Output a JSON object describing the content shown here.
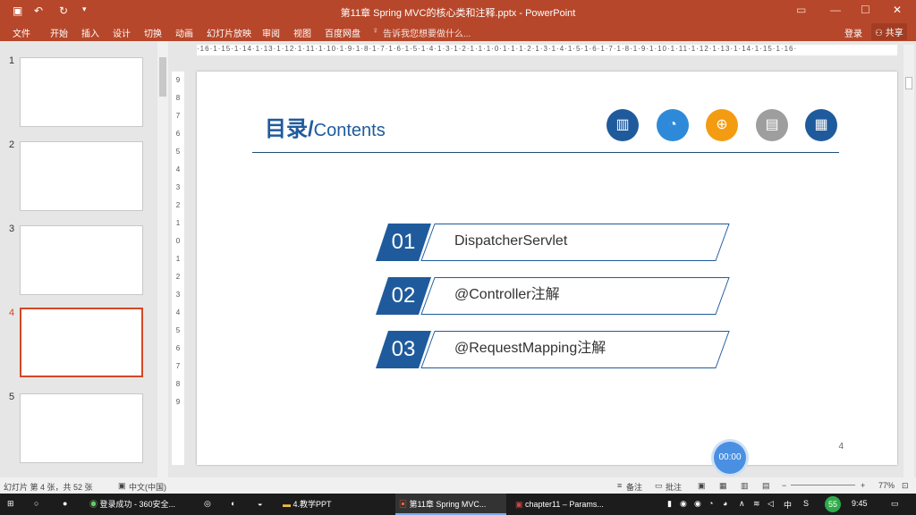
{
  "window": {
    "title": "第11章 Spring MVC的核心类和注释.pptx - PowerPoint",
    "quick_access": [
      "save-icon",
      "undo-icon",
      "redo-icon",
      "customize-icon"
    ],
    "controls": [
      "ribbon-options-icon",
      "minimize-icon",
      "maximize-icon",
      "close-icon"
    ]
  },
  "menu": {
    "items": [
      "文件",
      "开始",
      "插入",
      "设计",
      "切换",
      "动画",
      "幻灯片放映",
      "审阅",
      "视图",
      "百度网盘"
    ],
    "tell_me": "告诉我您想要做什么...",
    "login": "登录",
    "share": "共享"
  },
  "thumbnails": [
    {
      "num": "1"
    },
    {
      "num": "2"
    },
    {
      "num": "3"
    },
    {
      "num": "4",
      "active": true
    },
    {
      "num": "5"
    }
  ],
  "ruler_h": "·16·1·15·1·14·1·13·1·12·1·11·1·10·1·9·1·8·1·7·1·6·1·5·1·4·1·3·1·2·1·1·1·0·1·1·1·2·1·3·1·4·1·5·1·6·1·7·1·8·1·9·1·10·1·11·1·12·1·13·1·14·1·15·1·16·",
  "ruler_v": [
    "9",
    "8",
    "7",
    "6",
    "5",
    "4",
    "3",
    "2",
    "1",
    "0",
    "1",
    "2",
    "3",
    "4",
    "5",
    "6",
    "7",
    "8",
    "9"
  ],
  "slide": {
    "title_cn": "目录/",
    "title_en": "Contents",
    "icons": [
      {
        "name": "chart-icon",
        "color": "#1f5b9c",
        "glyph": "▥"
      },
      {
        "name": "pie-icon",
        "color": "#2e8ad8",
        "glyph": "◔"
      },
      {
        "name": "magnifier-icon",
        "color": "#f39c12",
        "glyph": "⊕"
      },
      {
        "name": "notebook-icon",
        "color": "#9e9e9e",
        "glyph": "▤"
      },
      {
        "name": "clipboard-icon",
        "color": "#1f5b9c",
        "glyph": "▦"
      }
    ],
    "items": [
      {
        "num": "01",
        "label": "DispatcherServlet"
      },
      {
        "num": "02",
        "label": "@Controller注解"
      },
      {
        "num": "03",
        "label": "@RequestMapping注解"
      }
    ],
    "page": "4"
  },
  "timer": "00:00",
  "status": {
    "slide_info": "幻灯片 第 4 张，共 52 张",
    "language": "中文(中国)",
    "notes": "备注",
    "comments": "批注",
    "zoom": "77%"
  },
  "taskbar": {
    "apps": [
      {
        "label": "登录成功 - 360安全..."
      },
      {
        "label": "4.教学PPT"
      },
      {
        "label": "第11章 Spring MVC...",
        "active": true
      },
      {
        "label": "chapter11 – Params..."
      }
    ],
    "ime": "中",
    "badge": "55",
    "clock": "9:45"
  }
}
